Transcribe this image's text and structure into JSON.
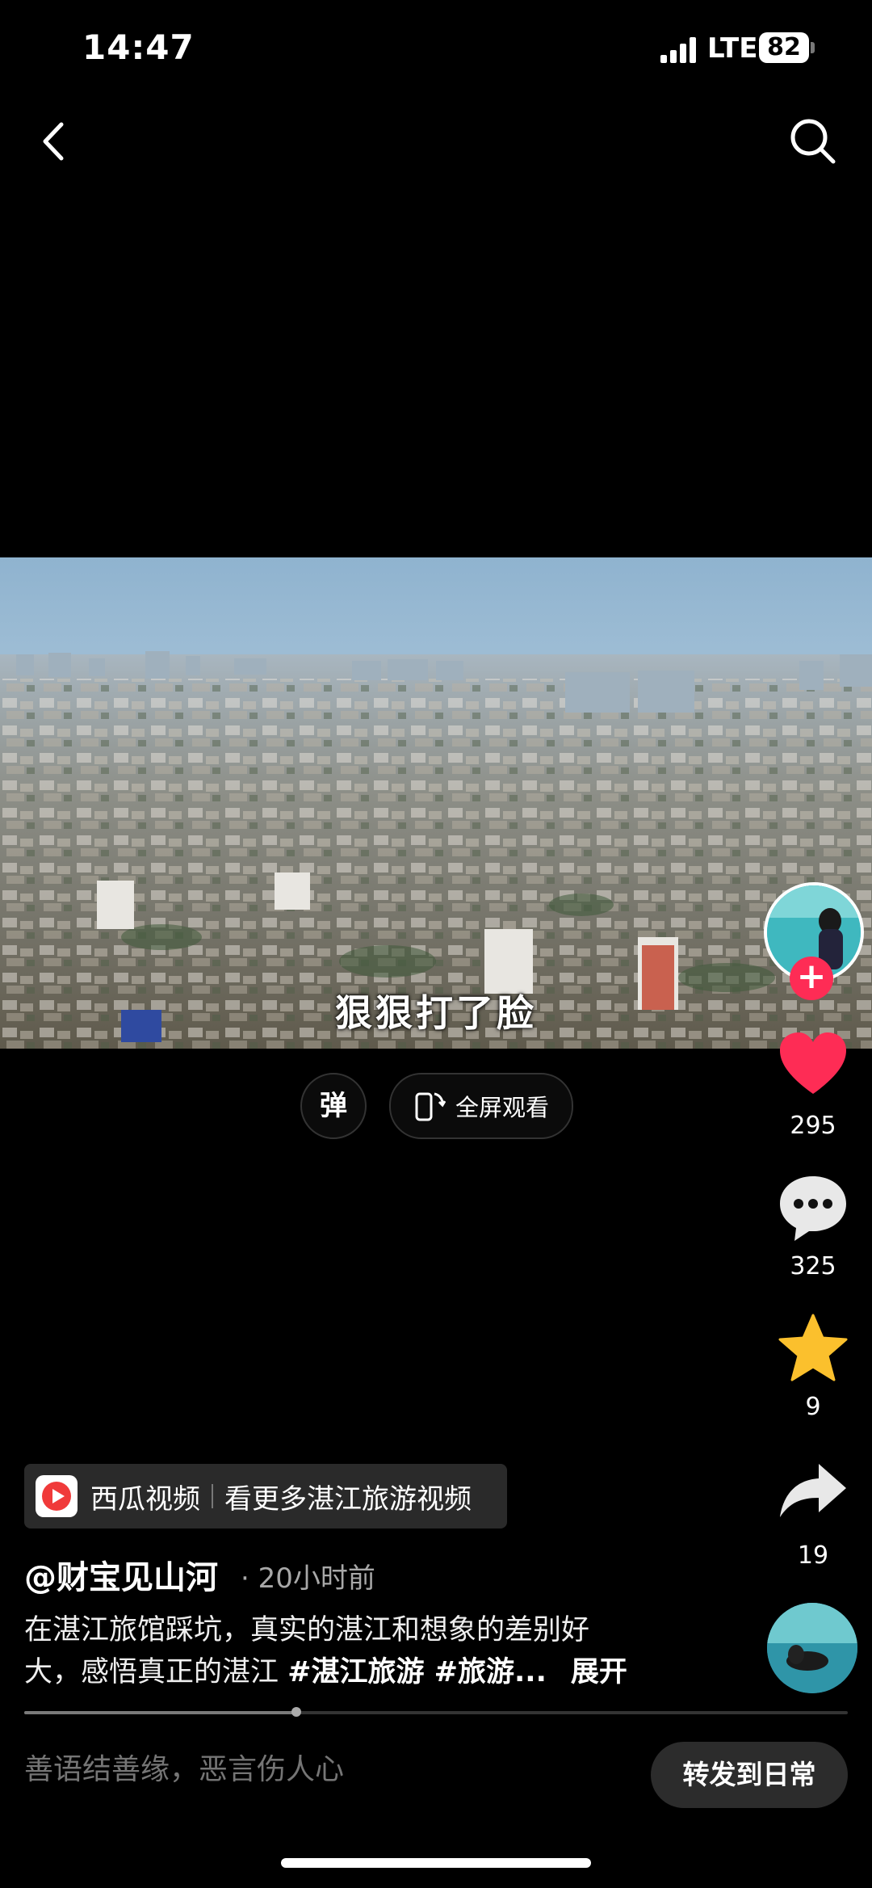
{
  "status_bar": {
    "time": "14:47",
    "network": "LTE",
    "battery": "82"
  },
  "nav": {
    "back_icon": "chevron-left-icon",
    "search_icon": "search-icon"
  },
  "video": {
    "subtitle": "狠狠打了脸"
  },
  "player_controls": {
    "danmu_label": "弹",
    "fullscreen_label": "全屏观看"
  },
  "actions": {
    "likes": "295",
    "comments": "325",
    "favorites": "9",
    "shares": "19",
    "colors": {
      "like": "#fe2c55",
      "favorite": "#fbc02d",
      "follow": "#fe2c55"
    }
  },
  "source": {
    "app_name": "西瓜视频",
    "more_text": "看更多湛江旅游视频"
  },
  "post": {
    "author": "@财宝见山河",
    "time": "· 20小时前",
    "desc_line1": "在湛江旅馆踩坑，真实的湛江和想象的差别好",
    "desc_line2": "大，感悟真正的湛江 ",
    "hashtags": "#湛江旅游 #旅游...",
    "expand": "展开"
  },
  "playback": {
    "progress": 0.33
  },
  "comment_bar": {
    "placeholder": "善语结善缘，恶言伤人心",
    "repost_label": "转发到日常"
  }
}
